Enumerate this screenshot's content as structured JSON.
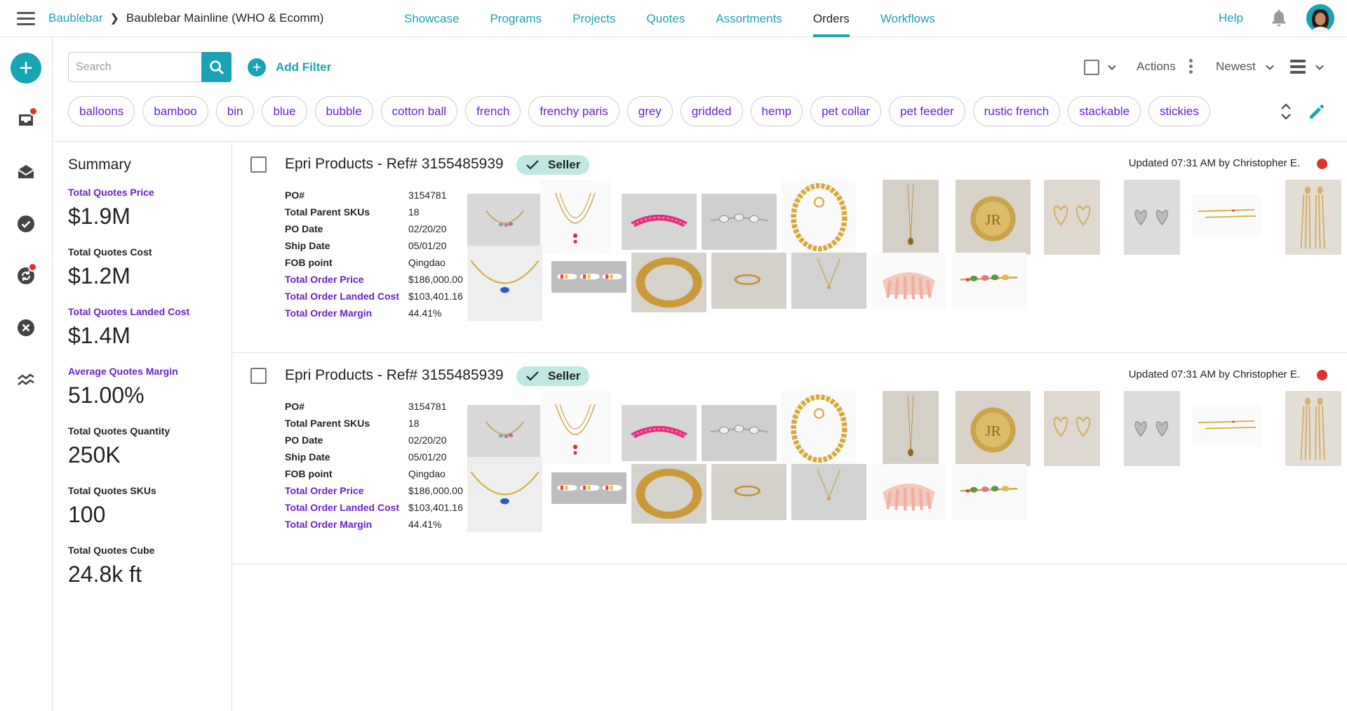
{
  "breadcrumb": {
    "root": "Baublebar",
    "current": "Baublebar Mainline (WHO & Ecomm)"
  },
  "nav": [
    {
      "label": "Showcase",
      "active": false
    },
    {
      "label": "Programs",
      "active": false
    },
    {
      "label": "Projects",
      "active": false
    },
    {
      "label": "Quotes",
      "active": false
    },
    {
      "label": "Assortments",
      "active": false
    },
    {
      "label": "Orders",
      "active": true
    },
    {
      "label": "Workflows",
      "active": false
    }
  ],
  "help_label": "Help",
  "toolbar": {
    "search_placeholder": "Search",
    "add_filter_label": "Add Filter",
    "actions_label": "Actions",
    "sort_label": "Newest"
  },
  "tags": [
    "balloons",
    "bamboo",
    "bin",
    "blue",
    "bubble",
    "cotton ball",
    "french",
    "frenchy paris",
    "grey",
    "gridded",
    "hemp",
    "pet collar",
    "pet feeder",
    "rustic french",
    "stackable",
    "stickies"
  ],
  "summary": {
    "title": "Summary",
    "stats": [
      {
        "label": "Total Quotes Price",
        "value": "$1.9M",
        "highlight": true
      },
      {
        "label": "Total Quotes Cost",
        "value": "$1.2M",
        "highlight": false
      },
      {
        "label": "Total Quotes Landed Cost",
        "value": "$1.4M",
        "highlight": true
      },
      {
        "label": "Average Quotes Margin",
        "value": "51.00%",
        "highlight": true
      },
      {
        "label": "Total Quotes Quantity",
        "value": "250K",
        "highlight": false
      },
      {
        "label": "Total Quotes SKUs",
        "value": "100",
        "highlight": false
      },
      {
        "label": "Total Quotes Cube",
        "value": "24.8k ft",
        "highlight": false
      }
    ]
  },
  "orders": [
    {
      "title": "Epri Products - Ref# 3155485939",
      "badge": "Seller",
      "updated": "Updated 07:31 AM by Christopher E.",
      "details": [
        {
          "label": "PO#",
          "value": "3154781",
          "highlight": false
        },
        {
          "label": "Total Parent SKUs",
          "value": "18",
          "highlight": false
        },
        {
          "label": "PO Date",
          "value": "02/20/20",
          "highlight": false
        },
        {
          "label": "Ship Date",
          "value": "05/01/20",
          "highlight": false
        },
        {
          "label": "FOB point",
          "value": "Qingdao",
          "highlight": false
        },
        {
          "label": "Total Order Price",
          "value": "$186,000.00",
          "highlight": true
        },
        {
          "label": "Total Order Landed Cost",
          "value": "$103,401.16",
          "highlight": true
        },
        {
          "label": "Total Order Margin",
          "value": "44.41%",
          "highlight": true
        }
      ]
    },
    {
      "title": "Epri Products - Ref# 3155485939",
      "badge": "Seller",
      "updated": "Updated 07:31 AM by Christopher E.",
      "details": [
        {
          "label": "PO#",
          "value": "3154781",
          "highlight": false
        },
        {
          "label": "Total Parent SKUs",
          "value": "18",
          "highlight": false
        },
        {
          "label": "PO Date",
          "value": "02/20/20",
          "highlight": false
        },
        {
          "label": "Ship Date",
          "value": "05/01/20",
          "highlight": false
        },
        {
          "label": "FOB point",
          "value": "Qingdao",
          "highlight": false
        },
        {
          "label": "Total Order Price",
          "value": "$186,000.00",
          "highlight": true
        },
        {
          "label": "Total Order Landed Cost",
          "value": "$103,401.16",
          "highlight": true
        },
        {
          "label": "Total Order Margin",
          "value": "44.41%",
          "highlight": true
        }
      ]
    }
  ],
  "product_thumbnails": [
    "necklace-thumbnail",
    "pendant-necklace-thumbnail",
    "pink-headband-thumbnail",
    "crystal-bracelet-thumbnail",
    "chain-necklace-thumbnail",
    "gold-necklace-thumbnail",
    "signet-ring-thumbnail",
    "heart-earrings-thumbnail",
    "heart-studs-thumbnail",
    "hair-pins-thumbnail",
    "tassel-earrings-thumbnail",
    "blue-pendant-thumbnail",
    "striped-clips-thumbnail",
    "gold-bangle-thumbnail",
    "thin-ring-thumbnail",
    "dainty-necklace-thumbnail",
    "pink-claw-clip-thumbnail",
    "floral-barrette-thumbnail"
  ],
  "colors": {
    "accent": "#1aa3b3",
    "purple": "#6a1fd0",
    "badge_bg": "#bfe8e2",
    "alert": "#e0312f"
  }
}
